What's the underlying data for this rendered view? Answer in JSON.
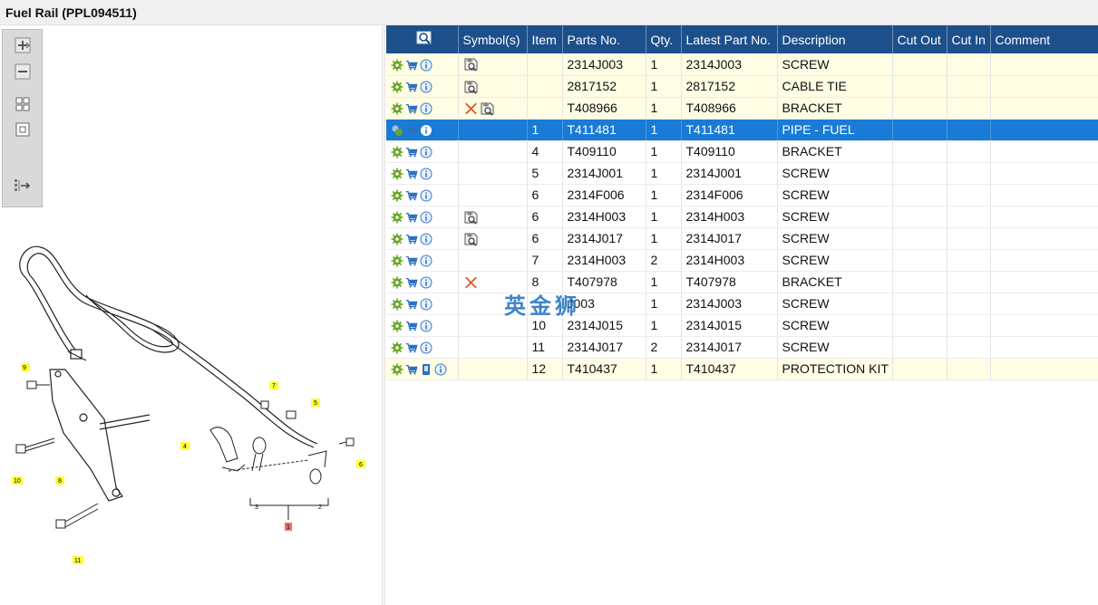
{
  "window": {
    "title": "Fuel Rail (PPL094511)"
  },
  "toolbar": {
    "buttons": [
      {
        "name": "zoom-in-icon"
      },
      {
        "name": "zoom-out-icon"
      },
      {
        "name": "fit-all-icon"
      },
      {
        "name": "actual-size-icon"
      },
      {
        "name": "export-icon"
      }
    ]
  },
  "diagram": {
    "callouts": [
      "9",
      "7",
      "5",
      "4",
      "6",
      "10",
      "8",
      "3",
      "2",
      "1",
      "11"
    ]
  },
  "grid": {
    "headers": [
      "",
      "Symbol(s)",
      "Item",
      "Parts No.",
      "Qty.",
      "Latest Part No.",
      "Description",
      "Cut Out",
      "Cut In",
      "Comment"
    ],
    "rows": [
      {
        "item": "",
        "part": "2314J003",
        "qty": "1",
        "latest": "2314J003",
        "desc": "SCREW",
        "symbols": [
          "view"
        ],
        "style": "yellow"
      },
      {
        "item": "",
        "part": "2817152",
        "qty": "1",
        "latest": "2817152",
        "desc": "CABLE TIE",
        "symbols": [
          "view"
        ],
        "style": "yellow"
      },
      {
        "item": "",
        "part": "T408966",
        "qty": "1",
        "latest": "T408966",
        "desc": "BRACKET",
        "symbols": [
          "x",
          "view"
        ],
        "style": "yellow"
      },
      {
        "item": "1",
        "part": "T411481",
        "qty": "1",
        "latest": "T411481",
        "desc": "PIPE - FUEL",
        "symbols": [],
        "style": "selected"
      },
      {
        "item": "4",
        "part": "T409110",
        "qty": "1",
        "latest": "T409110",
        "desc": "BRACKET",
        "symbols": [],
        "style": ""
      },
      {
        "item": "5",
        "part": "2314J001",
        "qty": "1",
        "latest": "2314J001",
        "desc": "SCREW",
        "symbols": [],
        "style": ""
      },
      {
        "item": "6",
        "part": "2314F006",
        "qty": "1",
        "latest": "2314F006",
        "desc": "SCREW",
        "symbols": [],
        "style": ""
      },
      {
        "item": "6",
        "part": "2314H003",
        "qty": "1",
        "latest": "2314H003",
        "desc": "SCREW",
        "symbols": [
          "view"
        ],
        "style": ""
      },
      {
        "item": "6",
        "part": "2314J017",
        "qty": "1",
        "latest": "2314J017",
        "desc": "SCREW",
        "symbols": [
          "view"
        ],
        "style": ""
      },
      {
        "item": "7",
        "part": "2314H003",
        "qty": "2",
        "latest": "2314H003",
        "desc": "SCREW",
        "symbols": [],
        "style": ""
      },
      {
        "item": "8",
        "part": "T407978",
        "qty": "1",
        "latest": "T407978",
        "desc": "BRACKET",
        "symbols": [
          "x"
        ],
        "style": ""
      },
      {
        "item": "",
        "part": "J003",
        "qty": "1",
        "latest": "2314J003",
        "desc": "SCREW",
        "symbols": [],
        "style": ""
      },
      {
        "item": "10",
        "part": "2314J015",
        "qty": "1",
        "latest": "2314J015",
        "desc": "SCREW",
        "symbols": [],
        "style": ""
      },
      {
        "item": "11",
        "part": "2314J017",
        "qty": "2",
        "latest": "2314J017",
        "desc": "SCREW",
        "symbols": [],
        "style": ""
      },
      {
        "item": "12",
        "part": "T410437",
        "qty": "1",
        "latest": "T410437",
        "desc": "PROTECTION KIT",
        "symbols": [],
        "style": "yellow",
        "kit": true
      }
    ]
  },
  "watermark": "英金狮",
  "colors": {
    "header": "#1d4f8b",
    "selected": "#1a7bd6",
    "highlight": "#fffde3",
    "gear": "#6aa526",
    "cart": "#2b6fc0",
    "info": "#3a78c8",
    "x": "#e0542a"
  }
}
